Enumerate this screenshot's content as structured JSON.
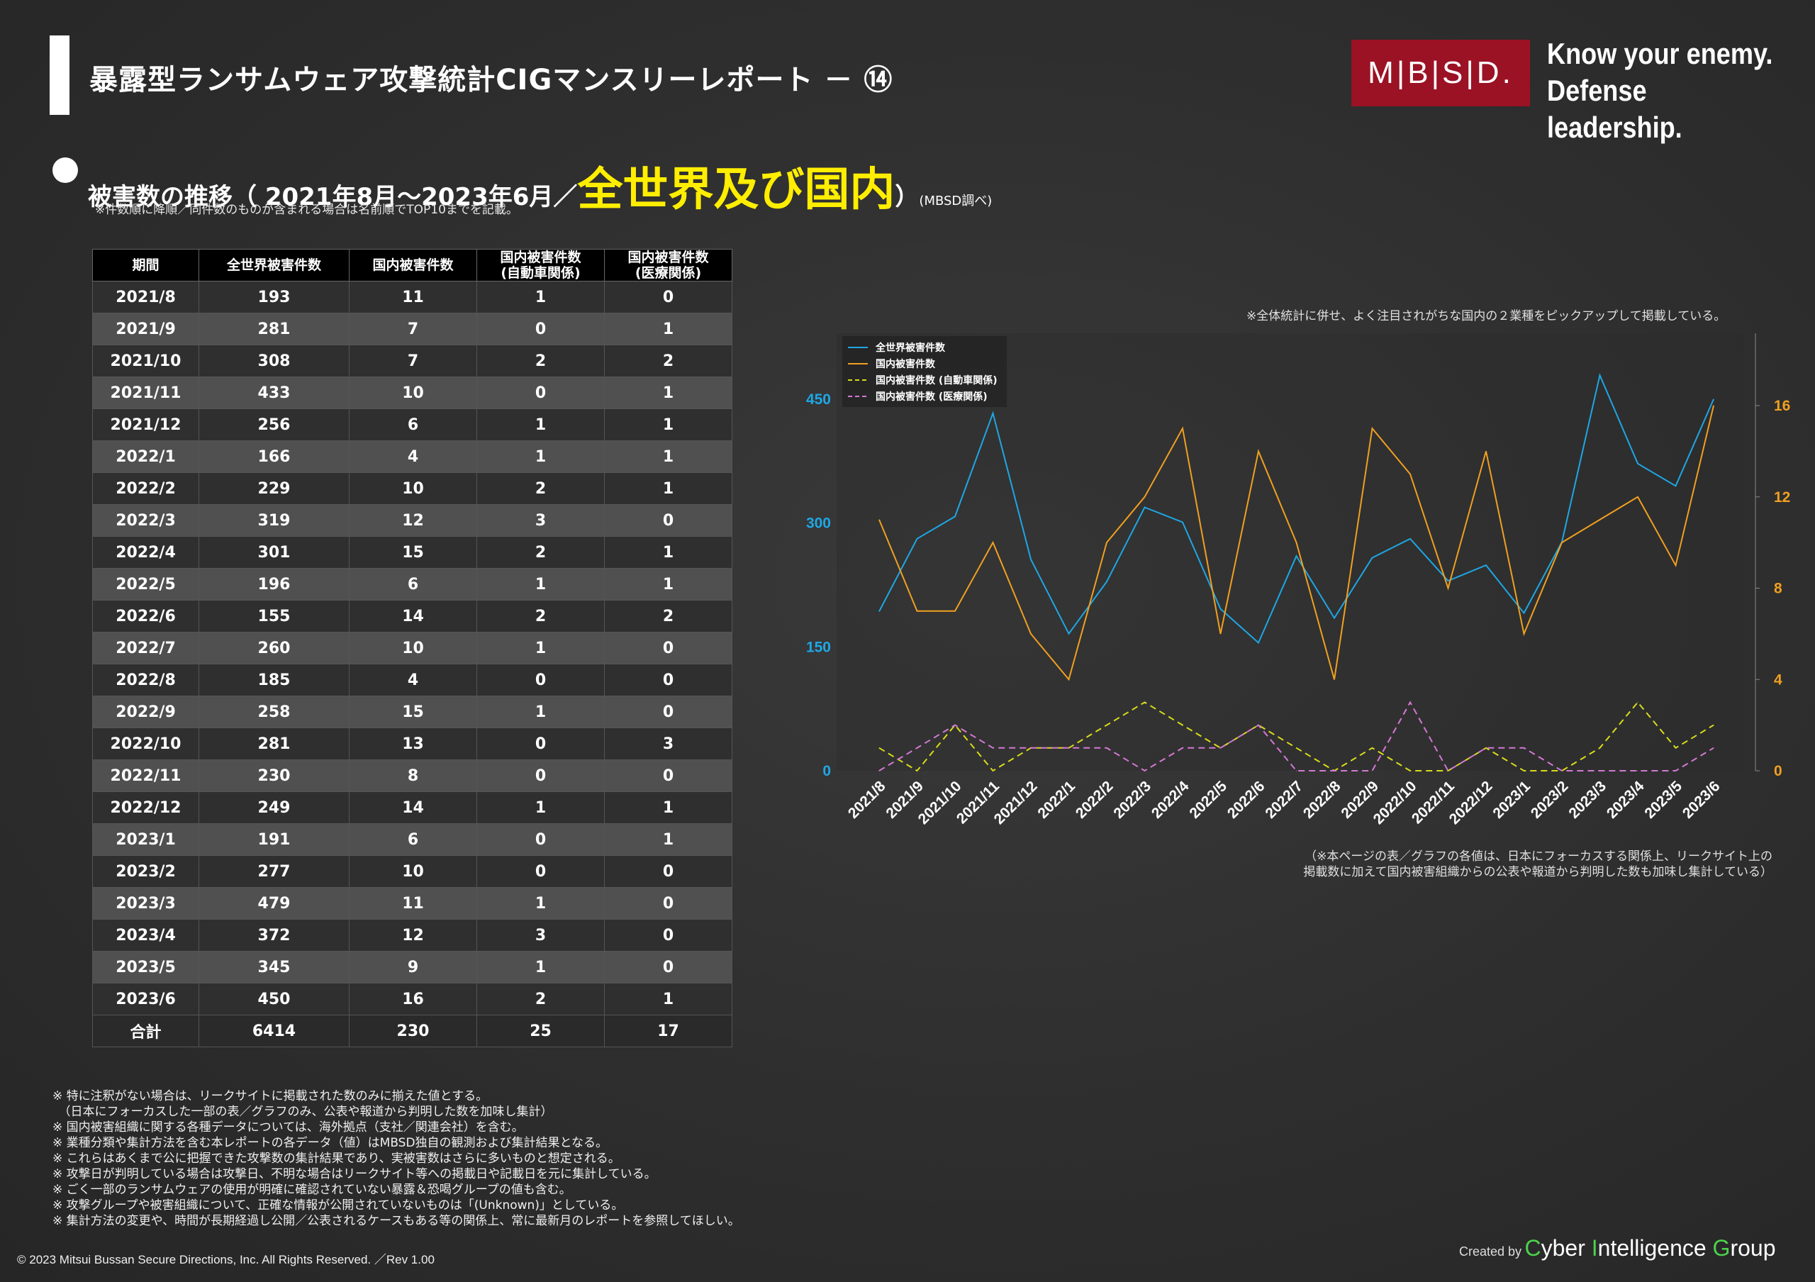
{
  "header": {
    "title": "暴露型ランサムウェア攻撃統計CIGマンスリーレポート － ⑭",
    "logo_letters": "M|B|S|D.",
    "tagline_1": "Know your enemy.",
    "tagline_2": "Defense leadership."
  },
  "section": {
    "title_pre": "被害数の推移（ 2021年8月～2023年6月／",
    "title_highlight": "全世界及び国内",
    "title_post": "）",
    "title_source": "(MBSD調べ)",
    "note": "※件数順に降順／同件数のものが含まれる場合は名前順でTOP10までを記載。"
  },
  "table": {
    "headers": [
      "期間",
      "全世界被害件数",
      "国内被害件数",
      "国内被害件数\n(自動車関係)",
      "国内被害件数\n(医療関係)"
    ],
    "rows": [
      [
        "2021/8",
        "193",
        "11",
        "1",
        "0"
      ],
      [
        "2021/9",
        "281",
        "7",
        "0",
        "1"
      ],
      [
        "2021/10",
        "308",
        "7",
        "2",
        "2"
      ],
      [
        "2021/11",
        "433",
        "10",
        "0",
        "1"
      ],
      [
        "2021/12",
        "256",
        "6",
        "1",
        "1"
      ],
      [
        "2022/1",
        "166",
        "4",
        "1",
        "1"
      ],
      [
        "2022/2",
        "229",
        "10",
        "2",
        "1"
      ],
      [
        "2022/3",
        "319",
        "12",
        "3",
        "0"
      ],
      [
        "2022/4",
        "301",
        "15",
        "2",
        "1"
      ],
      [
        "2022/5",
        "196",
        "6",
        "1",
        "1"
      ],
      [
        "2022/6",
        "155",
        "14",
        "2",
        "2"
      ],
      [
        "2022/7",
        "260",
        "10",
        "1",
        "0"
      ],
      [
        "2022/8",
        "185",
        "4",
        "0",
        "0"
      ],
      [
        "2022/9",
        "258",
        "15",
        "1",
        "0"
      ],
      [
        "2022/10",
        "281",
        "13",
        "0",
        "3"
      ],
      [
        "2022/11",
        "230",
        "8",
        "0",
        "0"
      ],
      [
        "2022/12",
        "249",
        "14",
        "1",
        "1"
      ],
      [
        "2023/1",
        "191",
        "6",
        "0",
        "1"
      ],
      [
        "2023/2",
        "277",
        "10",
        "0",
        "0"
      ],
      [
        "2023/3",
        "479",
        "11",
        "1",
        "0"
      ],
      [
        "2023/4",
        "372",
        "12",
        "3",
        "0"
      ],
      [
        "2023/5",
        "345",
        "9",
        "1",
        "0"
      ],
      [
        "2023/6",
        "450",
        "16",
        "2",
        "1"
      ]
    ],
    "total": [
      "合計",
      "6414",
      "230",
      "25",
      "17"
    ]
  },
  "chart_notes": {
    "top": "※全体統計に併せ、よく注目されがちな国内の２業種をピックアップして掲載している。",
    "bottom_1": "（※本ページの表／グラフの各値は、日本にフォーカスする関係上、リークサイト上の",
    "bottom_2": "掲載数に加えて国内被害組織からの公表や報道から判明した数も加味し集計している）"
  },
  "chart_data": {
    "type": "line",
    "categories": [
      "2021/8",
      "2021/9",
      "2021/10",
      "2021/11",
      "2021/12",
      "2022/1",
      "2022/2",
      "2022/3",
      "2022/4",
      "2022/5",
      "2022/6",
      "2022/7",
      "2022/8",
      "2022/9",
      "2022/10",
      "2022/11",
      "2022/12",
      "2023/1",
      "2023/2",
      "2023/3",
      "2023/4",
      "2023/5",
      "2023/6"
    ],
    "series": [
      {
        "name": "全世界被害件数",
        "axis": "left",
        "style": "solid",
        "color": "#1ea7e4",
        "values": [
          193,
          281,
          308,
          433,
          256,
          166,
          229,
          319,
          301,
          196,
          155,
          260,
          185,
          258,
          281,
          230,
          249,
          191,
          277,
          479,
          372,
          345,
          450
        ]
      },
      {
        "name": "国内被害件数",
        "axis": "right",
        "style": "solid",
        "color": "#f0a020",
        "values": [
          11,
          7,
          7,
          10,
          6,
          4,
          10,
          12,
          15,
          6,
          14,
          10,
          4,
          15,
          13,
          8,
          14,
          6,
          10,
          11,
          12,
          9,
          16
        ]
      },
      {
        "name": "国内被害件数 (自動車関係)",
        "axis": "right",
        "style": "dashed",
        "color": "#d8dc1a",
        "values": [
          1,
          0,
          2,
          0,
          1,
          1,
          2,
          3,
          2,
          1,
          2,
          1,
          0,
          1,
          0,
          0,
          1,
          0,
          0,
          1,
          3,
          1,
          2
        ]
      },
      {
        "name": "国内被害件数 (医療関係)",
        "axis": "right",
        "style": "dashed",
        "color": "#d479d6",
        "values": [
          0,
          1,
          2,
          1,
          1,
          1,
          1,
          0,
          1,
          1,
          2,
          0,
          0,
          0,
          3,
          0,
          1,
          1,
          0,
          0,
          0,
          0,
          1
        ]
      }
    ],
    "y_left": {
      "ticks": [
        0,
        150,
        300,
        450
      ],
      "range": [
        0,
        450
      ],
      "color": "#1ea7e4"
    },
    "y_right": {
      "ticks": [
        0,
        4,
        8,
        12,
        16
      ],
      "range": [
        0,
        16
      ],
      "color": "#f0a020"
    },
    "legend_position": "top-left",
    "grid": false
  },
  "footnotes": [
    "※ 特に注釈がない場合は、リークサイトに掲載された数のみに揃えた値とする。",
    "　（日本にフォーカスした一部の表／グラフのみ、公表や報道から判明した数を加味し集計）",
    "※ 国内被害組織に関する各種データについては、海外拠点（支社／関連会社）を含む。",
    "※ 業種分類や集計方法を含む本レポートの各データ（値）はMBSD独自の観測および集計結果となる。",
    "※ これらはあくまで公に把握できた攻撃数の集計結果であり、実被害数はさらに多いものと想定される。",
    "※ 攻撃日が判明している場合は攻撃日、不明な場合はリークサイト等への掲載日や記載日を元に集計している。",
    "※ ごく一部のランサムウェアの使用が明確に確認されていない暴露＆恐喝グループの値も含む。",
    "※ 攻撃グループや被害組織について、正確な情報が公開されていないものは「(Unknown)」としている。",
    "※ 集計方法の変更や、時間が長期経過し公開／公表されるケースもある等の関係上、常に最新月のレポートを参照してほしい。"
  ],
  "footer": {
    "copyright": "© 2023 Mitsui Bussan Secure Directions, Inc.  All Rights Reserved. ／Rev 1.00",
    "created_by": "Created by",
    "cig_c": "C",
    "cig_yber": "yber ",
    "cig_i": "I",
    "cig_ntelligence": "ntelligence ",
    "cig_g": "G",
    "cig_roup": "roup"
  }
}
